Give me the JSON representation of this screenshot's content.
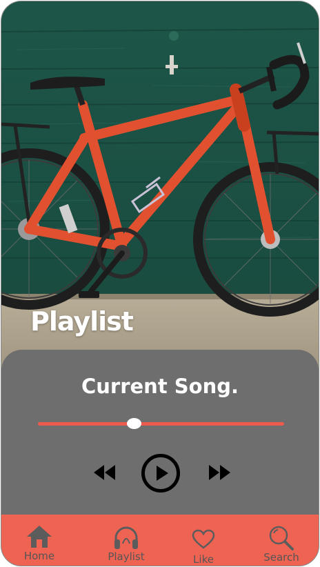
{
  "hero": {
    "title": "Playlist",
    "image": "red-bicycle-against-green-wall"
  },
  "player": {
    "current_song": "Current Song.",
    "progress_fraction": 0.39,
    "controls": {
      "rewind_icon": "rewind-icon",
      "play_icon": "play-circle-icon",
      "forward_icon": "fast-forward-icon"
    }
  },
  "nav": {
    "items": [
      {
        "label": "Home",
        "icon": "home-icon"
      },
      {
        "label": "Playlist",
        "icon": "headphones-icon"
      },
      {
        "label": "Like",
        "icon": "heart-icon"
      },
      {
        "label": "Search",
        "icon": "search-icon"
      }
    ]
  },
  "colors": {
    "accent": "#ef6353",
    "panel": "#6e6e6e",
    "wall": "#1f5a4e",
    "bike": "#e2512f",
    "text_light": "#ffffff",
    "nav_text": "#555555"
  }
}
